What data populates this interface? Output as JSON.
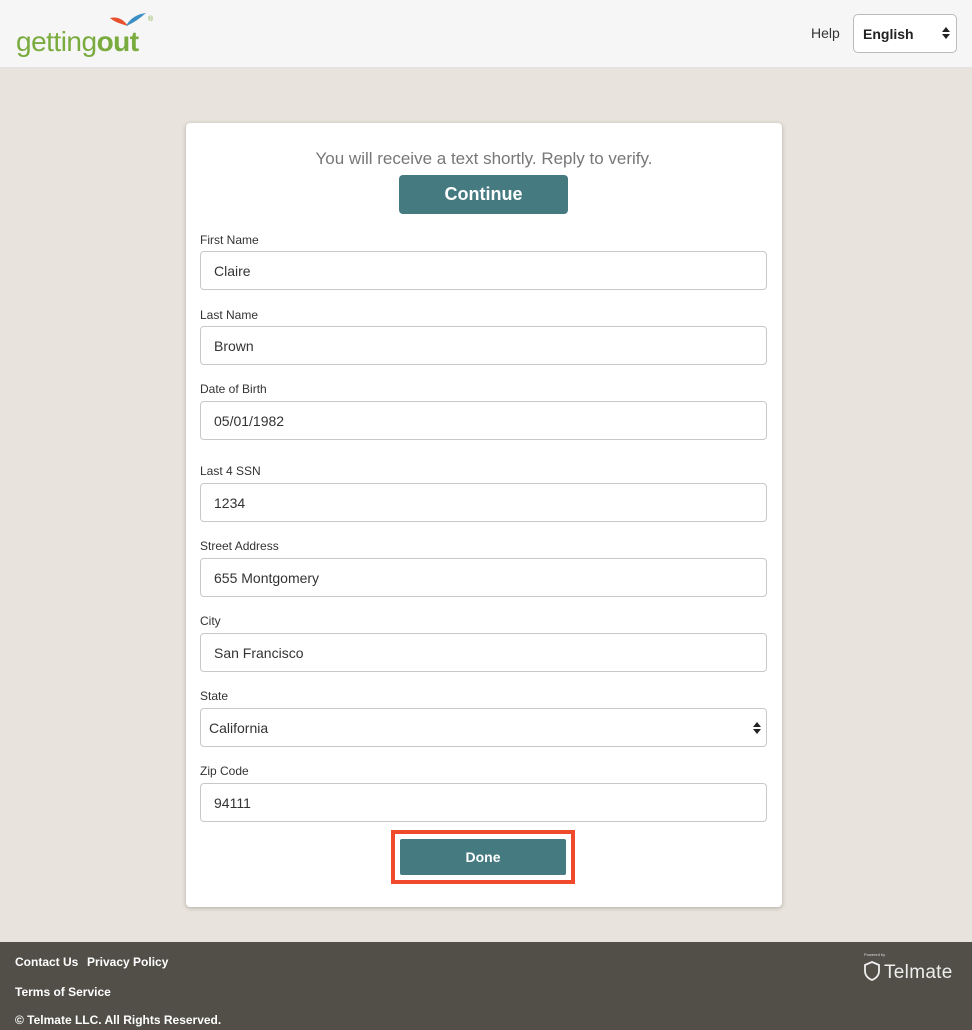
{
  "header": {
    "logo_light": "getting",
    "logo_bold": "out",
    "logo_reg": "®",
    "help_label": "Help",
    "language": "English"
  },
  "form": {
    "notice": "You will receive a text shortly. Reply to verify.",
    "continue_label": "Continue",
    "first_name_label": "First Name",
    "first_name_value": "Claire",
    "last_name_label": "Last Name",
    "last_name_value": "Brown",
    "dob_label": "Date of Birth",
    "dob_value": "05/01/1982",
    "ssn_label": "Last 4 SSN",
    "ssn_value": "1234",
    "street_label": "Street Address",
    "street_value": "655 Montgomery",
    "city_label": "City",
    "city_value": "San Francisco",
    "state_label": "State",
    "state_value": "California",
    "zip_label": "Zip Code",
    "zip_value": "94111",
    "done_label": "Done"
  },
  "footer": {
    "contact_label": "Contact Us",
    "privacy_label": "Privacy Policy",
    "terms_label": "Terms of Service",
    "copyright": "© Telmate LLC. All Rights Reserved.",
    "powered_by": "Powered by",
    "brand": "Telmate",
    "shield_icon": "shield-icon"
  },
  "colors": {
    "accent": "#447a80",
    "highlight": "#ee4a2b",
    "logo_green": "#7aab3f",
    "footer_bg": "#514f48",
    "page_bg": "#e8e3dc"
  }
}
